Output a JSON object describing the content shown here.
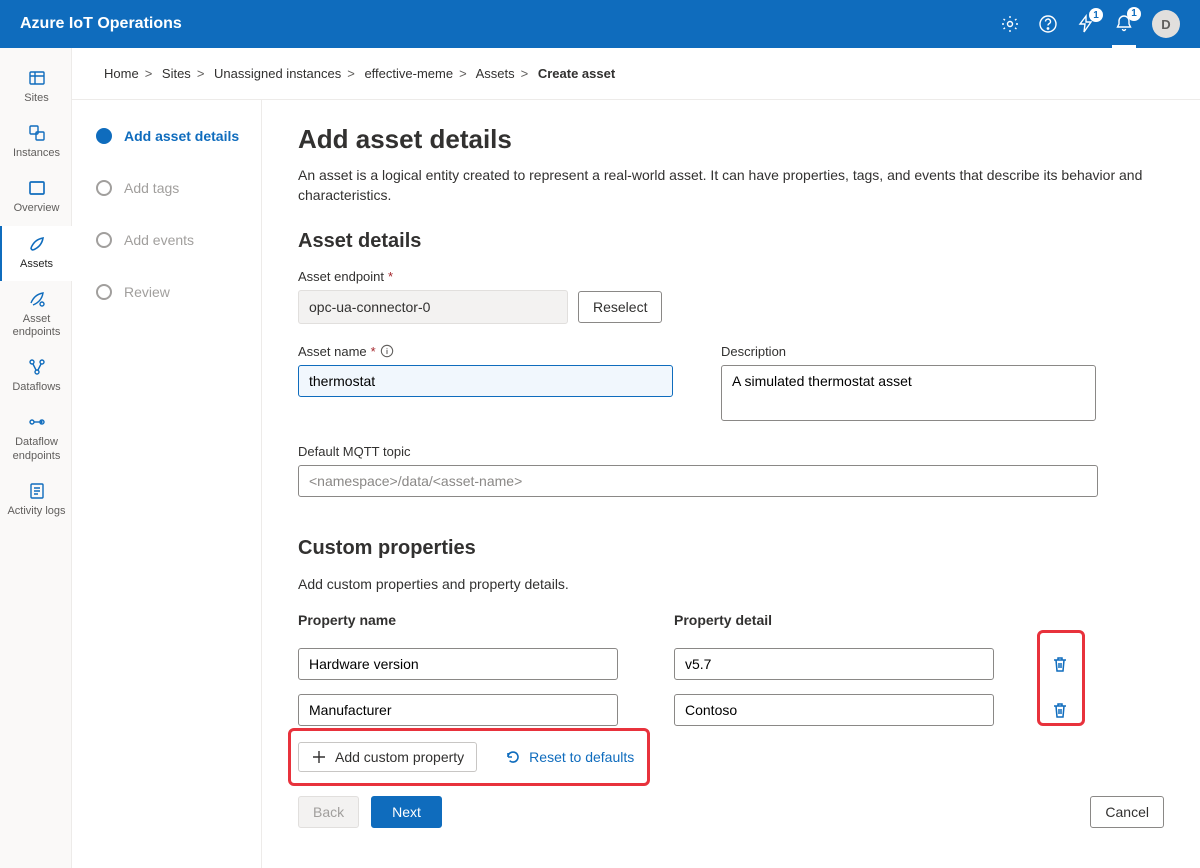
{
  "topbar": {
    "title": "Azure IoT Operations",
    "badge1": "1",
    "badge2": "1",
    "avatar": "D"
  },
  "nav": {
    "sites": "Sites",
    "instances": "Instances",
    "overview": "Overview",
    "assets": "Assets",
    "asset_endpoints": "Asset endpoints",
    "dataflows": "Dataflows",
    "dataflow_endpoints": "Dataflow endpoints",
    "activity_logs": "Activity logs"
  },
  "breadcrumb": {
    "items": [
      "Home",
      "Sites",
      "Unassigned instances",
      "effective-meme",
      "Assets"
    ],
    "current": "Create asset"
  },
  "steps": {
    "s1": "Add asset details",
    "s2": "Add tags",
    "s3": "Add events",
    "s4": "Review"
  },
  "page": {
    "title": "Add asset details",
    "intro": "An asset is a logical entity created to represent a real-world asset. It can have properties, tags, and events that describe its behavior and characteristics.",
    "section_details": "Asset details",
    "label_endpoint": "Asset endpoint",
    "endpoint_value": "opc-ua-connector-0",
    "btn_reselect": "Reselect",
    "label_name": "Asset name",
    "name_value": "thermostat",
    "label_description": "Description",
    "description_value": "A simulated thermostat asset",
    "label_mqtt": "Default MQTT topic",
    "mqtt_placeholder": "<namespace>/data/<asset-name>",
    "section_custom": "Custom properties",
    "custom_intro": "Add custom properties and property details.",
    "col_name": "Property name",
    "col_detail": "Property detail",
    "rows": [
      {
        "name": "Hardware version",
        "detail": "v5.7"
      },
      {
        "name": "Manufacturer",
        "detail": "Contoso"
      }
    ],
    "btn_add_prop": "Add custom property",
    "btn_reset": "Reset to defaults"
  },
  "footer": {
    "back": "Back",
    "next": "Next",
    "cancel": "Cancel"
  }
}
